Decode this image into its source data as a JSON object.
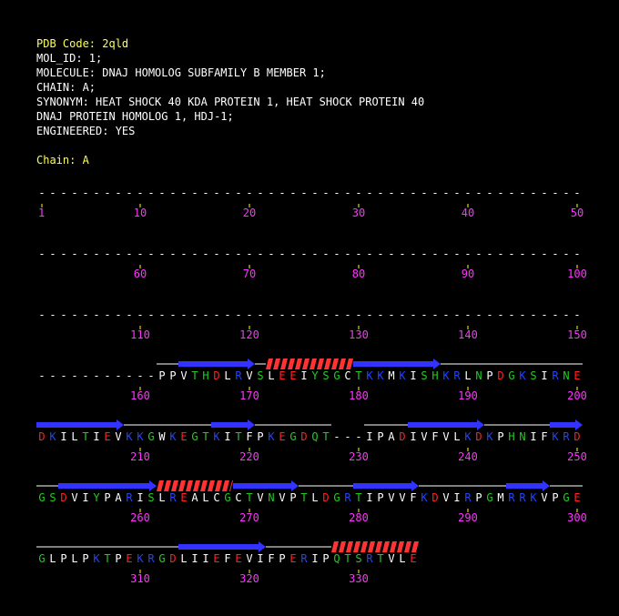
{
  "header": {
    "pdb_code": "PDB Code: 2qld",
    "mol_id": "MOL_ID: 1;",
    "molecule": "MOLECULE: DNAJ HOMOLOG SUBFAMILY B MEMBER 1;",
    "chain": "CHAIN: A;",
    "synonym": "SYNONYM: HEAT SHOCK 40 KDA PROTEIN 1, HEAT SHOCK PROTEIN 40",
    "synonym_cont": "DNAJ PROTEIN HOMOLOG 1, HDJ-1;",
    "engineered": "ENGINEERED: YES",
    "chain_label": "Chain: A"
  },
  "colors": {
    "background": "#000000",
    "header_text": "#ffffff",
    "code_text": "#ffff55",
    "tick_number": "#ff33ff",
    "tick_mark": "#ffff00",
    "dash": "#ffffff",
    "strand": "#3333ff",
    "helix": "#ff3333",
    "coil": "#ffffff",
    "residue_hydrophobic": "#ffffff",
    "residue_polar": "#22cc22",
    "residue_basic": "#2244ff",
    "residue_acidic": "#ff2222"
  },
  "rows": [
    {
      "start": 1,
      "sequence": "--------------------------------------------------",
      "tick_labels": [
        "1",
        "10",
        "20",
        "30",
        "40",
        "50"
      ],
      "structure": []
    },
    {
      "start": 51,
      "sequence": "--------------------------------------------------",
      "tick_labels": [
        "60",
        "70",
        "80",
        "90",
        "100"
      ],
      "structure": []
    },
    {
      "start": 101,
      "sequence": "--------------------------------------------------",
      "tick_labels": [
        "110",
        "120",
        "130",
        "140",
        "150"
      ],
      "structure": []
    },
    {
      "start": 151,
      "sequence": "-----------PPVTHDLRVSLEEIYSGCTKKMKISHKRLNPDGKSIRNE",
      "tick_labels": [
        "160",
        "170",
        "180",
        "190",
        "200"
      ],
      "structure": [
        {
          "type": "coil",
          "from": 162,
          "to": 163
        },
        {
          "type": "strand",
          "from": 164,
          "to": 170
        },
        {
          "type": "coil",
          "from": 171,
          "to": 171
        },
        {
          "type": "helix",
          "from": 172,
          "to": 179
        },
        {
          "type": "strand",
          "from": 180,
          "to": 187
        },
        {
          "type": "coil",
          "from": 188,
          "to": 200
        }
      ]
    },
    {
      "start": 201,
      "sequence": "DKILTIEVKKGWKEGTKITFPKEGDQT---IPADIVFVLKDKPHNIFKRD",
      "tick_labels": [
        "210",
        "220",
        "230",
        "240",
        "250"
      ],
      "structure": [
        {
          "type": "strand",
          "from": 201,
          "to": 208
        },
        {
          "type": "coil",
          "from": 209,
          "to": 216
        },
        {
          "type": "strand",
          "from": 217,
          "to": 220
        },
        {
          "type": "coil",
          "from": 221,
          "to": 227
        },
        {
          "type": "coil",
          "from": 231,
          "to": 234
        },
        {
          "type": "strand",
          "from": 235,
          "to": 241
        },
        {
          "type": "coil",
          "from": 242,
          "to": 247
        },
        {
          "type": "strand",
          "from": 248,
          "to": 250
        }
      ]
    },
    {
      "start": 251,
      "sequence": "GSDVIYPARISLREALCGCTVNVPTLDGRTIPVVFKDVIRPGMRRKVPGE",
      "tick_labels": [
        "260",
        "270",
        "280",
        "290",
        "300"
      ],
      "structure": [
        {
          "type": "coil",
          "from": 251,
          "to": 252
        },
        {
          "type": "strand",
          "from": 253,
          "to": 261
        },
        {
          "type": "helix",
          "from": 262,
          "to": 268
        },
        {
          "type": "strand",
          "from": 269,
          "to": 274
        },
        {
          "type": "coil",
          "from": 275,
          "to": 279
        },
        {
          "type": "strand",
          "from": 280,
          "to": 285
        },
        {
          "type": "coil",
          "from": 286,
          "to": 293
        },
        {
          "type": "strand",
          "from": 294,
          "to": 297
        },
        {
          "type": "coil",
          "from": 298,
          "to": 300
        }
      ]
    },
    {
      "start": 301,
      "sequence": "GLPLPKTPEKRGDLIIEFEVIFPERIPQTSRTVLE",
      "tick_labels": [
        "310",
        "320",
        "330"
      ],
      "structure": [
        {
          "type": "coil",
          "from": 301,
          "to": 313
        },
        {
          "type": "strand",
          "from": 314,
          "to": 321
        },
        {
          "type": "coil",
          "from": 322,
          "to": 327
        },
        {
          "type": "helix",
          "from": 328,
          "to": 335
        }
      ]
    }
  ]
}
